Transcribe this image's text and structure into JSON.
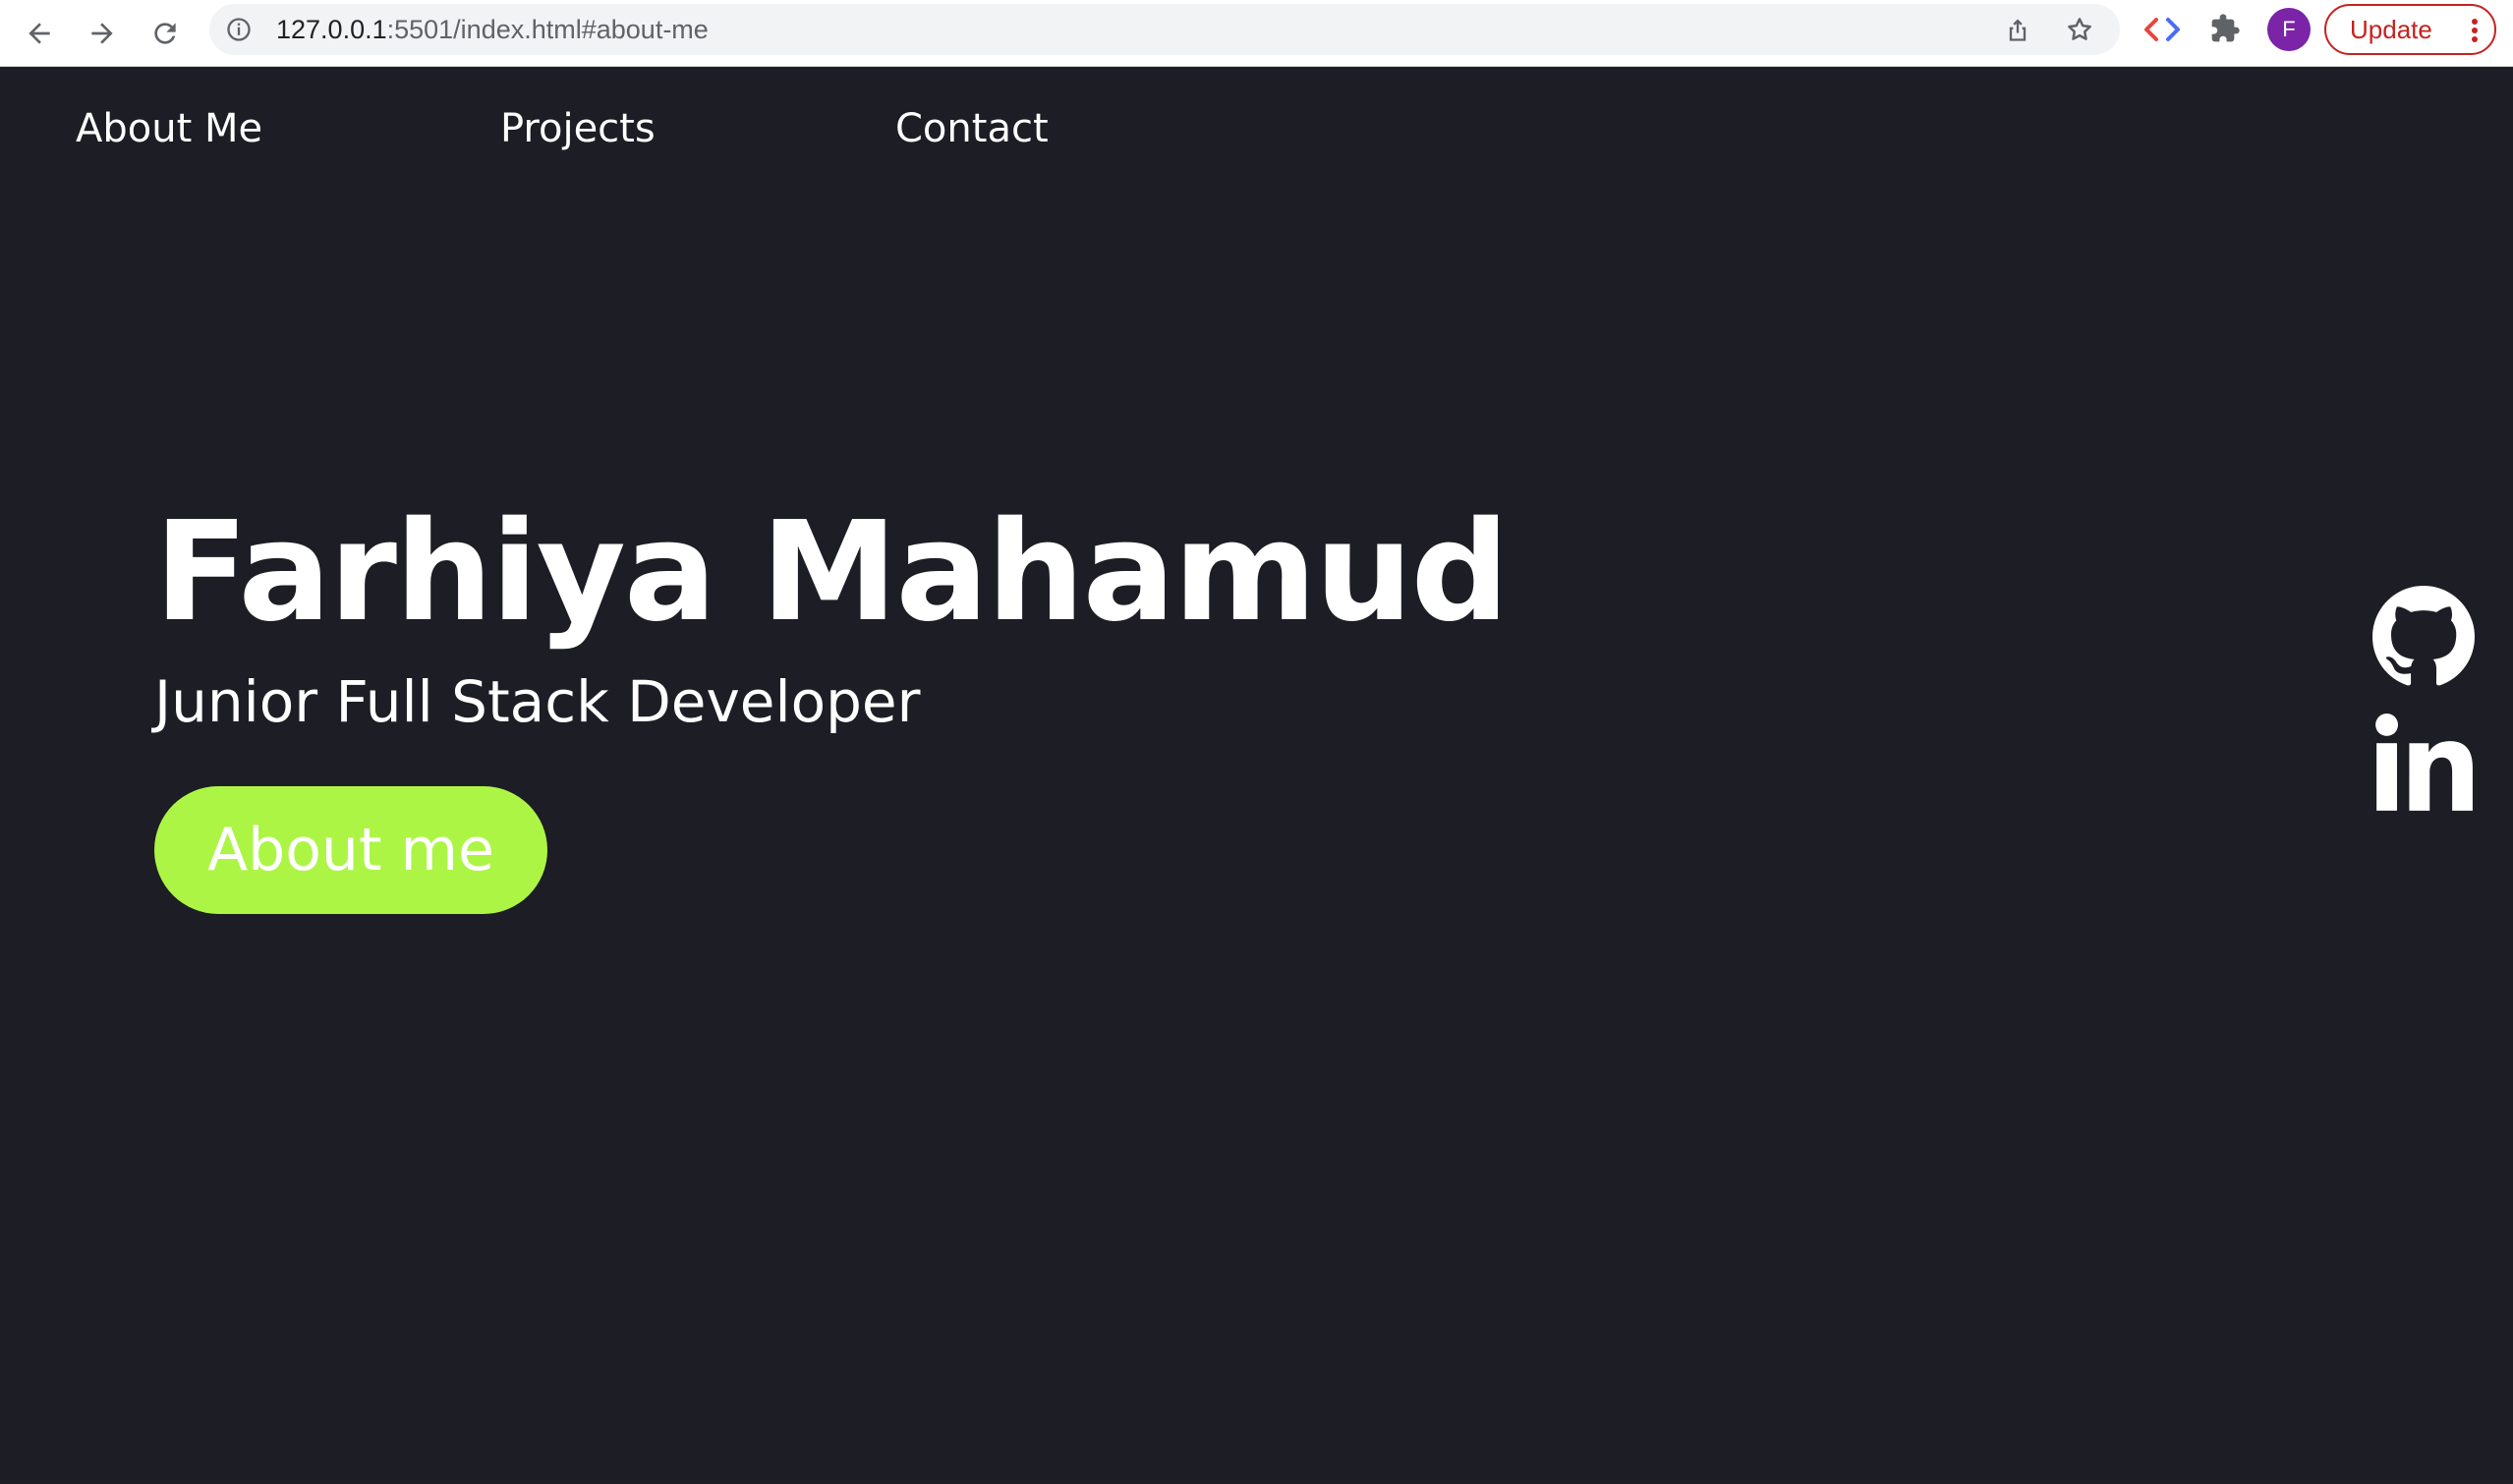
{
  "browser": {
    "url_host": "127.0.0.1",
    "url_rest": ":5501/index.html#about-me",
    "avatar_initial": "F",
    "update_label": "Update"
  },
  "nav": {
    "items": [
      {
        "label": "About Me"
      },
      {
        "label": "Projects"
      },
      {
        "label": "Contact"
      }
    ]
  },
  "hero": {
    "name": "Farhiya Mahamud",
    "subtitle": "Junior Full Stack Developer",
    "button_label": "About me"
  },
  "social": {
    "icons": [
      "github-icon",
      "linkedin-icon"
    ]
  },
  "colors": {
    "background": "#1d1d25",
    "accent": "#adf545",
    "text": "#ffffff",
    "avatar": "#7b24a8",
    "update": "#c5221f"
  }
}
